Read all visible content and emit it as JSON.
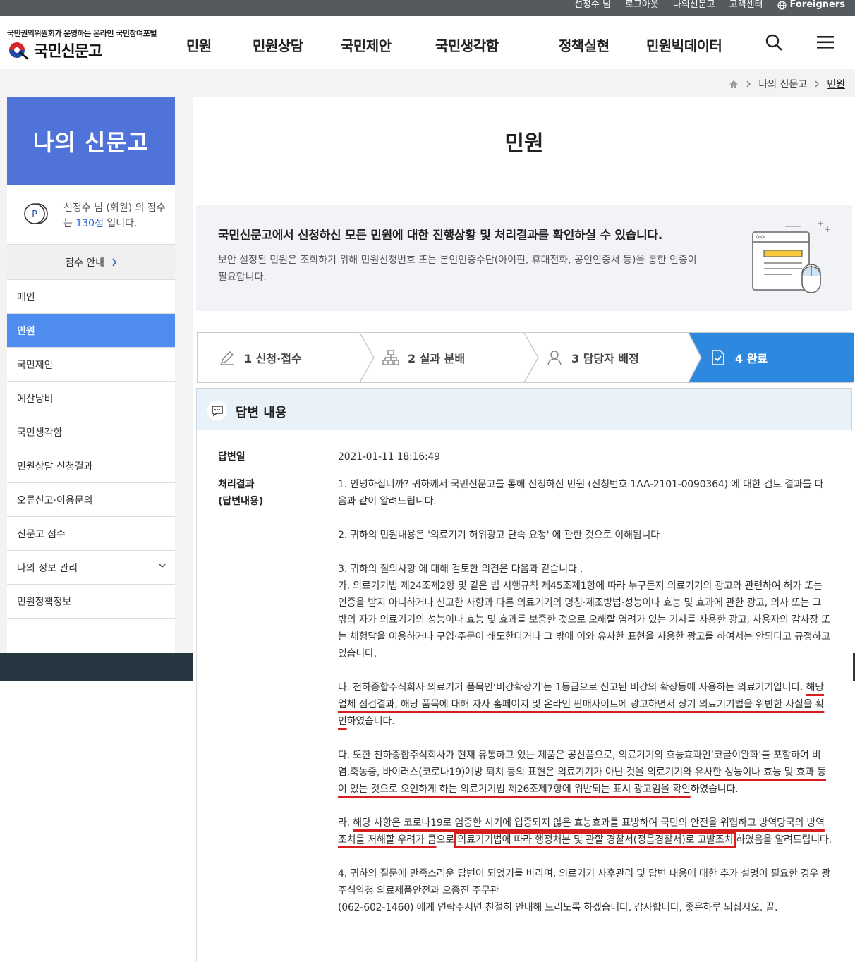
{
  "util": {
    "user": "선정수 님",
    "logout": "로그아웃",
    "my": "나의신문고",
    "support": "고객센터",
    "foreign": "Foreigners"
  },
  "header": {
    "logo_sub": "국민권익위원회가 운영하는 온라인 국민참여포털",
    "logo_name": "국민신문고",
    "nav": [
      "민원",
      "민원상담",
      "국민제안",
      "국민생각함",
      "정책실현",
      "민원빅데이터"
    ]
  },
  "breadcrumb": {
    "level1": "나의 신문고",
    "current": "민원"
  },
  "sidebar": {
    "title": "나의 신문고",
    "points_text_a": "선정수 님 (회원) 의 점수는 ",
    "points_value": "130점",
    "points_text_b": " 입니다.",
    "score_guide": "점수 안내",
    "items": [
      "메인",
      "민원",
      "국민제안",
      "예산낭비",
      "국민생각함",
      "민원상담 신청결과",
      "오류신고·이용문의",
      "신문고 점수",
      "나의 정보 관리",
      "민원정책정보"
    ],
    "active_index": 1
  },
  "page": {
    "title": "민원"
  },
  "info": {
    "heading": "국민신문고에서 신청하신 모든 민원에 대한 진행상황 및 처리결과를 확인하실 수 있습니다.",
    "desc": "보안 설정된 민원은 조회하기 위해 민원신청번호 또는 본인인증수단(아이핀, 휴대전화, 공인인증서 등)을 통한 인증이 필요합니다."
  },
  "steps": [
    {
      "label": "1 신청·접수",
      "icon": "pencil-icon"
    },
    {
      "label": "2 실과 분배",
      "icon": "org-chart-icon"
    },
    {
      "label": "3 담당자 배정",
      "icon": "person-icon"
    },
    {
      "label": "4 완료",
      "icon": "check-doc-icon"
    }
  ],
  "answer": {
    "heading": "답변 내용",
    "date_label": "답변일",
    "date_value": "2021-01-11 18:16:49",
    "result_label_1": "처리결과",
    "result_label_2": "(답변내용)",
    "p1": "1. 안녕하십니까? 귀하께서 국민신문고를 통해 신청하신 민원 (신청번호 1AA-2101-0090364) 에 대한 검토 결과를 다음과 같이 알려드립니다.",
    "p2": "2. 귀하의 민원내용은 '의료기기 허위광고 단속 요청' 에 관한 것으로 이해됩니다",
    "p3a": "3. 귀하의 질의사항 에 대해 검토한 의견은 다음과 같습니다 .",
    "p3b": "가. 의료기기법 제24조제2항 및 같은 법 시행규칙 제45조제1항에 따라 누구든지 의료기기의 광고와 관련하여 허가 또는 인증을 받지 아니하거나 신고한 사항과 다른 의료기기의 명칭·제조방법·성능이나 효능 및 효과에 관한 광고, 의사 또는 그 밖의 자가 의료기기의 성능이나 효능 및 효과를 보증한 것으로 오해할 염려가 있는 기사를 사용한 광고, 사용자의 감사장 또는 체험담을 이용하거나 구입·주문이 쇄도한다거나 그 밖에 이와 유사한 표현을 사용한 광고를 하여서는 안되다고 규정하고 있습니다.",
    "p4a": "나. 천하종합주식회사 의료기기 품목인‘비강확장기'는 1등급으로 신고된 비강의 확장등에 사용하는 의료기기입니다. ",
    "p4b": "해당업체 점검결과, 해당 품목에 대해 자사 홈페이지 및 온라인 판매사이트에 광고하면서 상기 의료기기법을 위반한 사실을 확인",
    "p4c": "하였습니다.",
    "p5a": "다. 또한 천하종합주식회사가 현재 유통하고 있는 제품은 공산품으로, 의료기기의 효능효과인‘코골이완화'를 포함하여 비염,축농증, 바이러스(코로나19)예방 퇴치 등의 표현은 ",
    "p5b": "의료기기가 아닌 것을 의료기기와 유사한 성능이나 효능 및 효과 등이 있는 것으로 오인하게 하는 의료기기법 제26조제7항에 위반되는 표시 광고임을 확인",
    "p5c": "하였습니다.",
    "p6a": "라. ",
    "p6b": "해당 사항은 코로나19로 엄중한 시기에 입증되지 않은 효능효과를 표방하여 국민의 안전을 위협하고 방역당국의 방역조치를 저해할 우려가 큼",
    "p6c": "으로 ",
    "p6d": "의료기기법에 따라 행정처분 및 관할 경찰서(정읍경찰서)로 고발조치",
    "p6e": " 하였음을 알려드립니다.",
    "p7a": "4. 귀하의 질문에 만족스러운 답변이 되었기를 바라며, 의료기기 사후관리 및 답변 내용에 대한 추가 설명이 필요한 경우 광주식약청 의료제품안전과 오종진 주무관",
    "p7b": "(062-602-1460) 에게 연락주시면 친절히 안내해 드리도록 하겠습니다. 감사합니다, 좋은하루 되십시오. 끝."
  }
}
